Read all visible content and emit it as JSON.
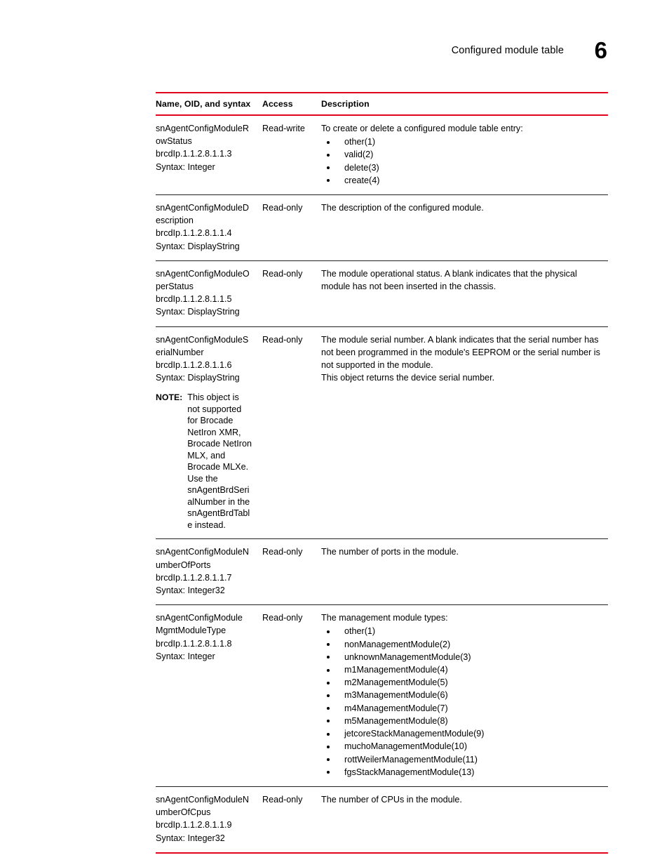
{
  "header": {
    "chapter_title": "Configured module table",
    "chapter_number": "6"
  },
  "table": {
    "columns": {
      "name": "Name, OID, and syntax",
      "access": "Access",
      "description": "Description"
    },
    "rows": [
      {
        "name_lines": [
          "snAgentConfigModuleR",
          "owStatus",
          "brcdIp.1.1.2.8.1.1.3",
          "Syntax: Integer"
        ],
        "access": "Read-write",
        "desc_paragraphs": [
          "To create or delete a configured module table entry:"
        ],
        "bullets": [
          "other(1)",
          "valid(2)",
          "delete(3)",
          "create(4)"
        ]
      },
      {
        "name_lines": [
          "snAgentConfigModuleD",
          "escription",
          "brcdIp.1.1.2.8.1.1.4",
          "Syntax: DisplayString"
        ],
        "access": "Read-only",
        "desc_paragraphs": [
          "The description of the configured module."
        ],
        "bullets": []
      },
      {
        "name_lines": [
          "snAgentConfigModuleO",
          "perStatus",
          "brcdIp.1.1.2.8.1.1.5",
          "Syntax: DisplayString"
        ],
        "access": "Read-only",
        "desc_paragraphs": [
          "The module operational status. A blank indicates that the physical module has not been inserted in the chassis."
        ],
        "bullets": []
      },
      {
        "name_lines": [
          "snAgentConfigModuleS",
          "erialNumber",
          "brcdIp.1.1.2.8.1.1.6",
          "Syntax: DisplayString"
        ],
        "access": "Read-only",
        "desc_paragraphs": [
          "The module serial number. A blank indicates that the serial number has not been programmed in the module's EEPROM or the serial number is not supported in the module.",
          "This object returns the device serial number."
        ],
        "bullets": [],
        "note": {
          "label": "NOTE:",
          "lines": [
            "This object is",
            "not supported",
            "for Brocade",
            "NetIron XMR,",
            "Brocade NetIron",
            "MLX, and",
            "Brocade MLXe.",
            "Use the",
            "snAgentBrdSeri",
            "alNumber in the",
            "snAgentBrdTabl",
            "e instead."
          ]
        }
      },
      {
        "name_lines": [
          "snAgentConfigModuleN",
          "umberOfPorts",
          "brcdIp.1.1.2.8.1.1.7",
          "Syntax: Integer32"
        ],
        "access": "Read-only",
        "desc_paragraphs": [
          "The number of ports in the module."
        ],
        "bullets": []
      },
      {
        "name_lines": [
          "snAgentConfigModule",
          "MgmtModuleType",
          "brcdIp.1.1.2.8.1.1.8",
          "Syntax: Integer"
        ],
        "access": "Read-only",
        "desc_paragraphs": [
          "The management module types:"
        ],
        "bullets": [
          "other(1)",
          "nonManagementModule(2)",
          "unknownManagementModule(3)",
          "m1ManagementModule(4)",
          "m2ManagementModule(5)",
          "m3ManagementModule(6)",
          "m4ManagementModule(7)",
          "m5ManagementModule(8)",
          "jetcoreStackManagementModule(9)",
          "muchoManagementModule(10)",
          "rottWeilerManagementModule(11)",
          "fgsStackManagementModule(13)"
        ]
      },
      {
        "name_lines": [
          "snAgentConfigModuleN",
          "umberOfCpus",
          "brcdIp.1.1.2.8.1.1.9",
          "Syntax: Integer32"
        ],
        "access": "Read-only",
        "desc_paragraphs": [
          "The number of CPUs in the module."
        ],
        "bullets": []
      }
    ]
  },
  "colors": {
    "rule_accent": "#e2041b",
    "rule_thin": "#231f20",
    "text": "#000000"
  }
}
